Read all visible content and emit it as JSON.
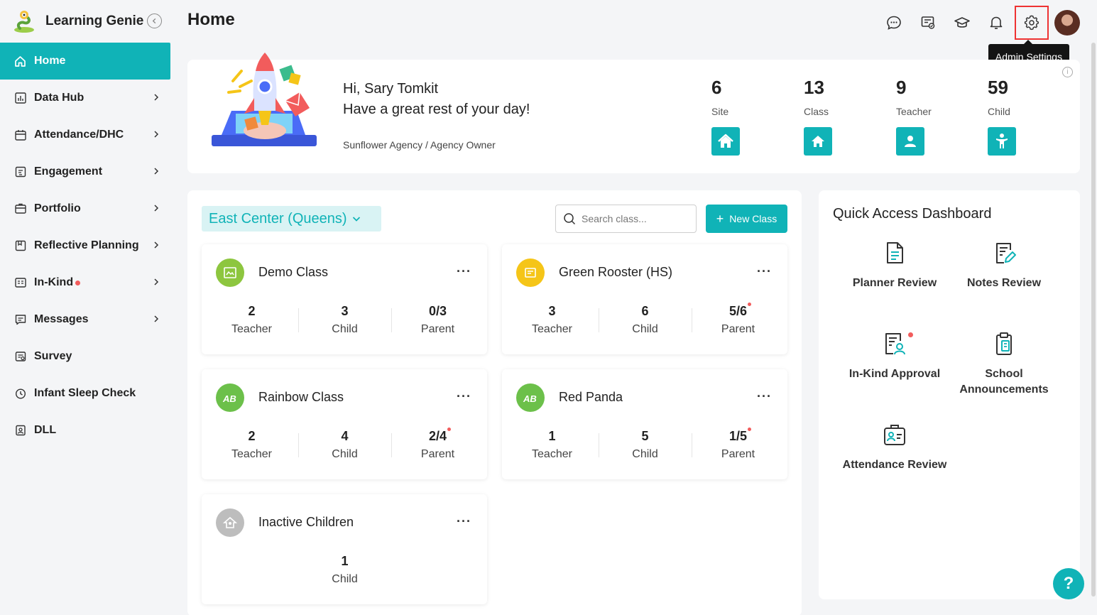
{
  "app": {
    "name": "Learning Genie"
  },
  "sidebar": {
    "items": [
      {
        "label": "Home",
        "icon": "home-icon",
        "active": true,
        "chevron": false
      },
      {
        "label": "Data Hub",
        "icon": "data-hub-icon",
        "chevron": true
      },
      {
        "label": "Attendance/DHC",
        "icon": "calendar-icon",
        "chevron": true
      },
      {
        "label": "Engagement",
        "icon": "engagement-icon",
        "chevron": true
      },
      {
        "label": "Portfolio",
        "icon": "portfolio-icon",
        "chevron": true
      },
      {
        "label": "Reflective Planning",
        "icon": "planning-icon",
        "chevron": true
      },
      {
        "label": "In-Kind",
        "icon": "in-kind-icon",
        "chevron": true,
        "dot": true
      },
      {
        "label": "Messages",
        "icon": "messages-icon",
        "chevron": true
      },
      {
        "label": "Survey",
        "icon": "survey-icon",
        "chevron": false
      },
      {
        "label": "Infant Sleep Check",
        "icon": "clock-icon",
        "chevron": false
      },
      {
        "label": "DLL",
        "icon": "dll-icon",
        "chevron": false
      }
    ]
  },
  "header": {
    "title": "Home",
    "tooltip": "Admin Settings"
  },
  "welcome": {
    "greeting": "Hi, Sary Tomkit",
    "message": "Have a great rest of your day!",
    "role": "Sunflower Agency / Agency Owner",
    "stats": [
      {
        "value": "6",
        "label": "Site",
        "icon": "site-icon"
      },
      {
        "value": "13",
        "label": "Class",
        "icon": "class-icon"
      },
      {
        "value": "9",
        "label": "Teacher",
        "icon": "teacher-icon"
      },
      {
        "value": "59",
        "label": "Child",
        "icon": "child-icon"
      }
    ]
  },
  "classes": {
    "center": "East Center (Queens)",
    "search_placeholder": "Search class...",
    "new_class_label": "New Class",
    "cards": [
      {
        "name": "Demo Class",
        "color": "#8dc63f",
        "metrics": [
          {
            "v": "2",
            "l": "Teacher"
          },
          {
            "v": "3",
            "l": "Child"
          },
          {
            "v": "0/3",
            "l": "Parent"
          }
        ]
      },
      {
        "name": "Green Rooster (HS)",
        "color": "#f5c518",
        "metrics": [
          {
            "v": "3",
            "l": "Teacher"
          },
          {
            "v": "6",
            "l": "Child"
          },
          {
            "v": "5/6",
            "l": "Parent",
            "dot": true
          }
        ]
      },
      {
        "name": "Rainbow Class",
        "color": "#6cc04a",
        "metrics": [
          {
            "v": "2",
            "l": "Teacher"
          },
          {
            "v": "4",
            "l": "Child"
          },
          {
            "v": "2/4",
            "l": "Parent",
            "dot": true
          }
        ]
      },
      {
        "name": "Red Panda",
        "color": "#6cc04a",
        "metrics": [
          {
            "v": "1",
            "l": "Teacher"
          },
          {
            "v": "5",
            "l": "Child"
          },
          {
            "v": "1/5",
            "l": "Parent",
            "dot": true
          }
        ]
      },
      {
        "name": "Inactive Children",
        "color": "#bdbdbd",
        "metrics": [
          {
            "v": "1",
            "l": "Child"
          }
        ]
      }
    ]
  },
  "quick_access": {
    "title": "Quick Access Dashboard",
    "items": [
      {
        "label": "Planner Review",
        "icon": "planner-review-icon"
      },
      {
        "label": "Notes Review",
        "icon": "notes-review-icon"
      },
      {
        "label": "In-Kind Approval",
        "icon": "in-kind-approval-icon",
        "dot": true
      },
      {
        "label": "School Announcements",
        "icon": "school-announcements-icon"
      },
      {
        "label": "Attendance Review",
        "icon": "attendance-review-icon"
      }
    ]
  },
  "help": {
    "label": "?"
  },
  "colors": {
    "accent": "#10b3b7",
    "alert": "#f25c5c"
  }
}
